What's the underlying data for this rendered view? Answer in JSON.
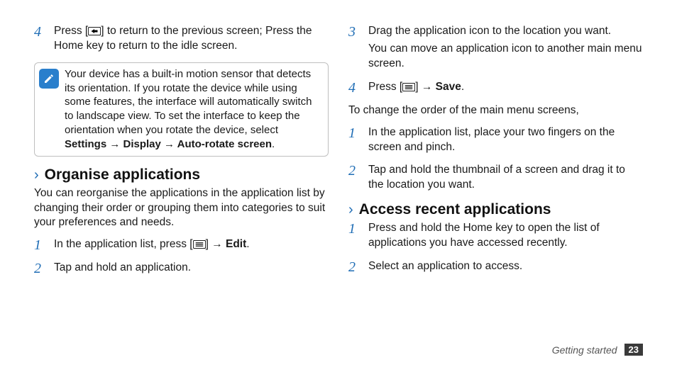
{
  "left": {
    "step4": {
      "num": "4",
      "text_a": "Press [",
      "text_b": "] to return to the previous screen; Press the Home key to return to the idle screen."
    },
    "callout": {
      "text_a": "Your device has a built-in motion sensor that detects its orientation. If you rotate the device while using some features, the interface will automatically switch to landscape view. To set the interface to keep the orientation when you rotate the device, select ",
      "bold_path": "Settings → Display → Auto-rotate screen",
      "text_b": "."
    },
    "heading": "Organise applications",
    "intro": "You can reorganise the applications in the application list by changing their order or grouping them into categories to suit your preferences and needs.",
    "step1": {
      "num": "1",
      "text_a": "In the application list, press [",
      "text_b": "] → ",
      "bold": "Edit",
      "text_c": "."
    },
    "step2": {
      "num": "2",
      "text": "Tap and hold an application."
    }
  },
  "right": {
    "step3": {
      "num": "3",
      "line1": "Drag the application icon to the location you want.",
      "line2": "You can move an application icon to another main menu screen."
    },
    "step4": {
      "num": "4",
      "text_a": "Press [",
      "text_b": "] → ",
      "bold": "Save",
      "text_c": "."
    },
    "midline": "To change the order of the main menu screens,",
    "step1b": {
      "num": "1",
      "text": "In the application list, place your two fingers on the screen and pinch."
    },
    "step2b": {
      "num": "2",
      "text": "Tap and hold the thumbnail of a screen and drag it to the location you want."
    },
    "heading": "Access recent applications",
    "stepA1": {
      "num": "1",
      "text": "Press and hold the Home key to open the list of applications you have accessed recently."
    },
    "stepA2": {
      "num": "2",
      "text": "Select an application to access."
    }
  },
  "footer": {
    "section": "Getting started",
    "page": "23"
  }
}
